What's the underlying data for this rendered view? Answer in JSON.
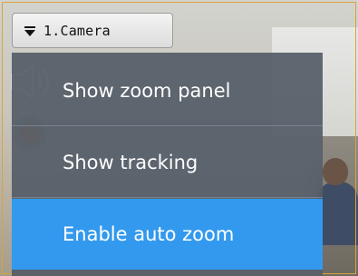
{
  "camera": {
    "title": "1.Camera"
  },
  "menu": {
    "items": [
      {
        "label": "Show zoom panel"
      },
      {
        "label": "Show tracking"
      },
      {
        "label": "Enable auto zoom"
      }
    ],
    "highlight_color": "#3399ee"
  },
  "icons": {
    "dropdown": "chevron-down-icon",
    "audio": "speaker-icon",
    "record": "record-indicator-icon"
  }
}
